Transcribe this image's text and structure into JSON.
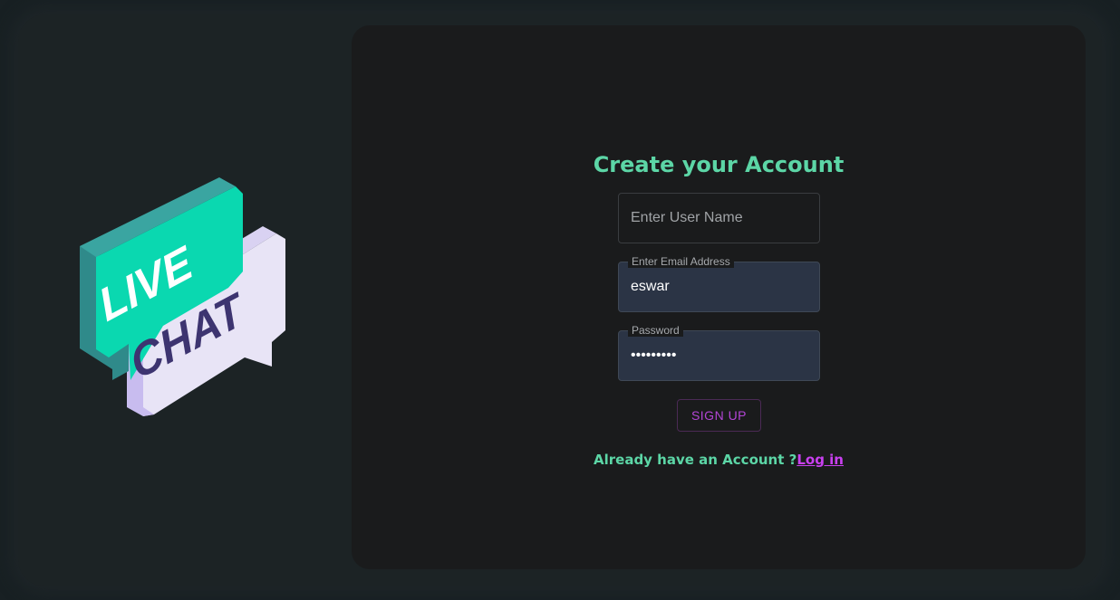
{
  "logo": {
    "word_top": "LIVE",
    "word_bottom": "CHAT",
    "colors": {
      "green": "#0ad8b0",
      "green_dark": "#2f8a8a",
      "lavender": "#e8e4f6",
      "lavender_dark": "#c8bcef",
      "text_dark": "#3d3470"
    }
  },
  "form": {
    "title": "Create your Account",
    "username": {
      "placeholder": "Enter User Name",
      "value": ""
    },
    "email": {
      "label": "Enter Email Address",
      "value": "eswar"
    },
    "password": {
      "label": "Password",
      "value": "•••••••••"
    },
    "submit_label": "SIGN UP",
    "footer_text": "Already have an Account ?",
    "login_link": "Log in"
  },
  "colors": {
    "accent_green": "#5cd6a6",
    "accent_purple": "#c940f0",
    "background": "#182023"
  }
}
